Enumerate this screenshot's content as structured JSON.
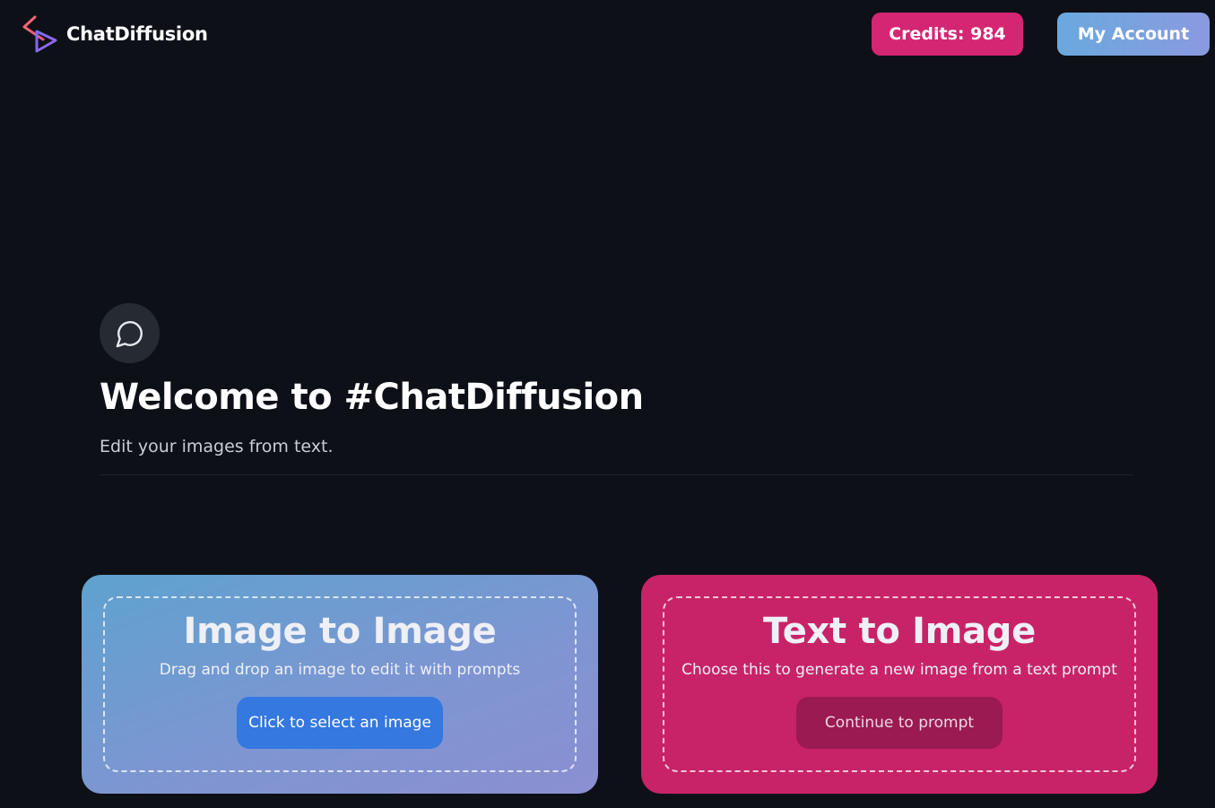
{
  "header": {
    "brand": "ChatDiffusion",
    "credits_label": "Credits: 984",
    "account_label": "My Account"
  },
  "hero": {
    "icon": "chat-bubble-icon",
    "title": "Welcome to #ChatDiffusion",
    "subtitle": "Edit your images from text."
  },
  "cards": {
    "image_to_image": {
      "title": "Image to Image",
      "description": "Drag and drop an image to edit it with prompts",
      "button": "Click to select an image"
    },
    "text_to_image": {
      "title": "Text to Image",
      "description": "Choose this to generate a new image from a text prompt",
      "button": "Continue to prompt"
    }
  },
  "colors": {
    "background": "#0d1017",
    "credits": "#d42673",
    "account_gradient": [
      "#6aa9dd",
      "#8a9ae0"
    ],
    "text_to_image_card": "#c82368",
    "select_button": "#3478e0",
    "continue_button": "#9a1a51"
  }
}
